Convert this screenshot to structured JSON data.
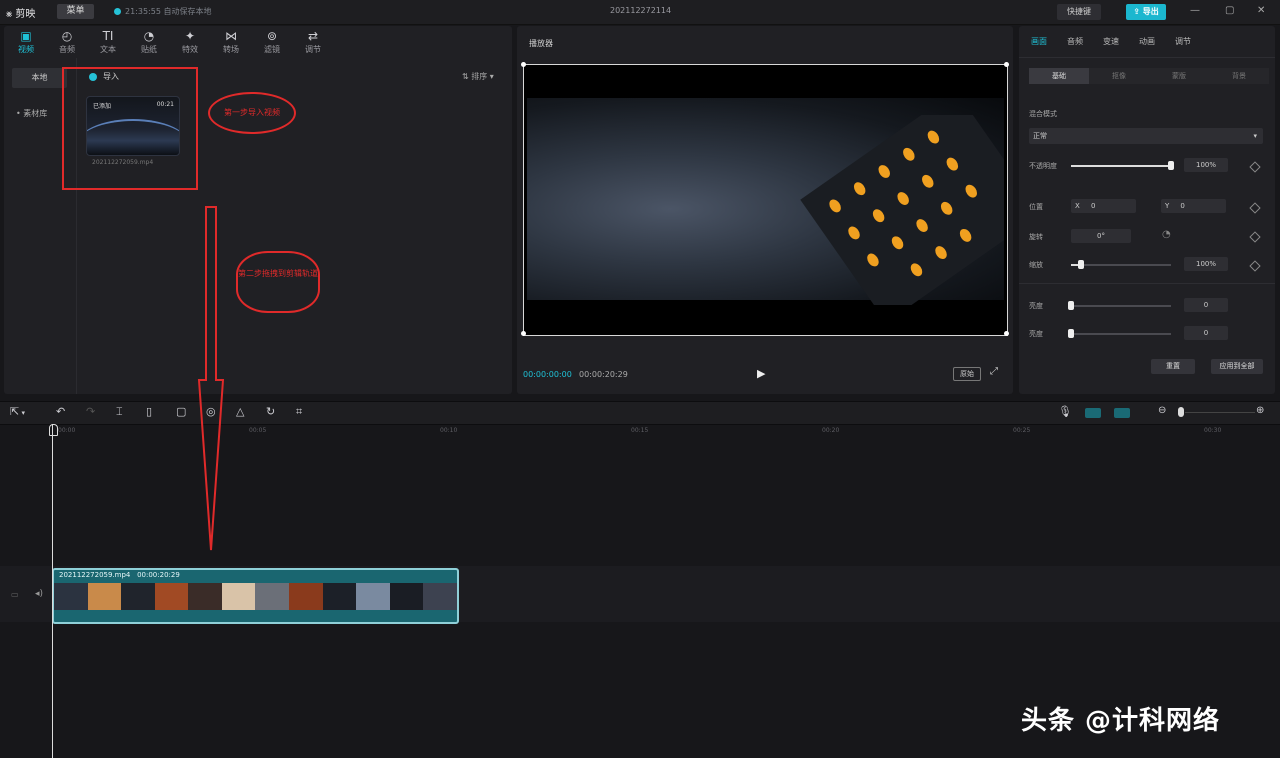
{
  "titlebar": {
    "app_name": "剪映",
    "menu": "菜单",
    "save_status": "21:35:55 自动保存本地",
    "project_title": "202112272114",
    "shortcuts": "快捷键",
    "export": "导出"
  },
  "media_toolbar": {
    "tools": [
      {
        "label": "视频",
        "icon": "video-icon",
        "glyph": "▣"
      },
      {
        "label": "音频",
        "icon": "audio-icon",
        "glyph": "◴"
      },
      {
        "label": "文本",
        "icon": "text-icon",
        "glyph": "TI"
      },
      {
        "label": "贴纸",
        "icon": "sticker-icon",
        "glyph": "◔"
      },
      {
        "label": "特效",
        "icon": "effects-icon",
        "glyph": "✦"
      },
      {
        "label": "转场",
        "icon": "transition-icon",
        "glyph": "⋈"
      },
      {
        "label": "滤镜",
        "icon": "filter-icon",
        "glyph": "⊚"
      },
      {
        "label": "调节",
        "icon": "adjust-icon",
        "glyph": "⇄"
      }
    ]
  },
  "media": {
    "side_local": "本地",
    "side_imported": "• 素材库",
    "import_label": "导入",
    "sort_label": "排序",
    "thumb_tag": "已添加",
    "thumb_duration": "00:21",
    "thumb_name": "202112272059.mp4"
  },
  "annotations": {
    "step1": "第一步导入视频",
    "step2": "第二步拖拽到剪辑轨道",
    "color": "#e02a2a"
  },
  "preview": {
    "title": "播放器",
    "current_time": "00:00:00:00",
    "total_time": "00:00:20:29",
    "ratio_label": "原始"
  },
  "props": {
    "tabs": [
      "画面",
      "音频",
      "变速",
      "动画",
      "调节"
    ],
    "subtabs": [
      "基础",
      "抠像",
      "蒙版",
      "背景"
    ],
    "blend_label": "混合模式",
    "blend_value": "正常",
    "opacity_label": "不透明度",
    "opacity_value": "100%",
    "opacity_level": 1.0,
    "position_label": "位置",
    "pos_x_label": "X",
    "pos_x": "0",
    "pos_y_label": "Y",
    "pos_y": "0",
    "rotate_label": "旋转",
    "rotate_value": "0°",
    "scale_label": "缩放",
    "scale_value": "100%",
    "scale_level": 0.1,
    "brightness_label": "亮度",
    "brightness_value": "0",
    "contrast_label": "亮度",
    "contrast_value": "0",
    "reset": "重置",
    "apply_all": "应用到全部"
  },
  "timeline": {
    "ticks": [
      "00:00",
      "00:05",
      "00:10",
      "00:15",
      "00:20",
      "00:25",
      "00:30"
    ],
    "clip_name": "202112272059.mp4",
    "clip_duration": "00:00:20:29"
  },
  "watermark": "头条 @计科网络",
  "colors": {
    "accent": "#1fc1d6",
    "clip": "#1a6670"
  }
}
